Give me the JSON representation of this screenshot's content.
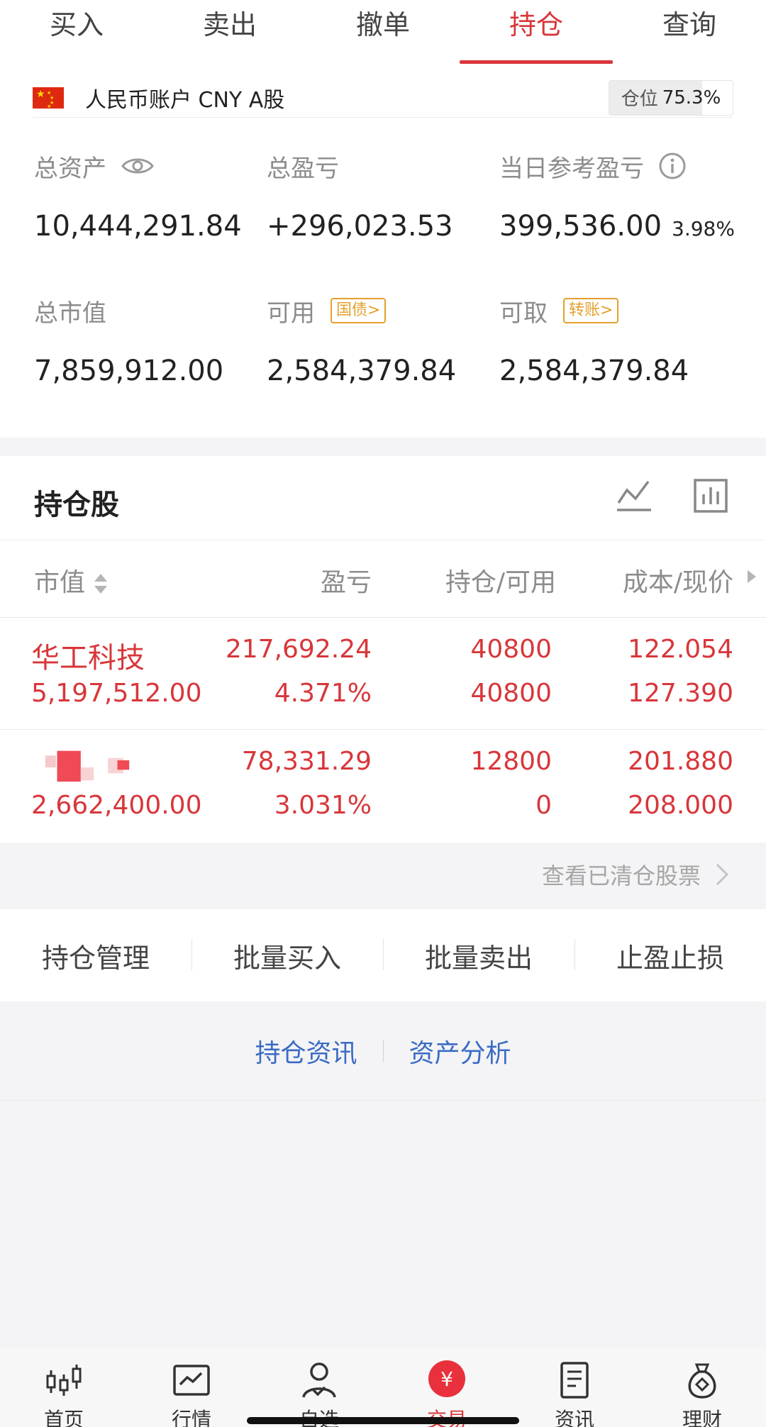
{
  "tabs": [
    "买入",
    "卖出",
    "撤单",
    "持仓",
    "查询"
  ],
  "active_tab": "持仓",
  "account": {
    "name": "人民币账户 CNY A股",
    "position_label": "仓位",
    "position_value": "75.3%"
  },
  "stats": {
    "total_assets_label": "总资产",
    "total_assets": "10,444,291.84",
    "total_pnl_label": "总盈亏",
    "total_pnl": "+296,023.53",
    "day_pnl_label": "当日参考盈亏",
    "day_pnl": "399,536.00",
    "day_pnl_pct": "3.98%",
    "market_value_label": "总市值",
    "market_value": "7,859,912.00",
    "available_label": "可用",
    "available_tag": "国债>",
    "available": "2,584,379.84",
    "withdrawable_label": "可取",
    "withdrawable_tag": "转账>",
    "withdrawable": "2,584,379.84"
  },
  "holdings": {
    "title": "持仓股",
    "columns": [
      "市值",
      "盈亏",
      "持仓/可用",
      "成本/现价"
    ],
    "rows": [
      {
        "name": "华工科技",
        "market_value": "5,197,512.00",
        "pnl": "217,692.24",
        "pnl_pct": "4.371%",
        "holding": "40800",
        "available": "40800",
        "cost": "122.054",
        "price": "127.390"
      },
      {
        "name": "",
        "market_value": "2,662,400.00",
        "pnl": "78,331.29",
        "pnl_pct": "3.031%",
        "holding": "12800",
        "available": "0",
        "cost": "201.880",
        "price": "208.000"
      }
    ],
    "view_cleared": "查看已清仓股票"
  },
  "actions": [
    "持仓管理",
    "批量买入",
    "批量卖出",
    "止盈止损"
  ],
  "links": [
    "持仓资讯",
    "资产分析"
  ],
  "bottom_nav": [
    {
      "label": "首页",
      "icon": "candlestick-icon"
    },
    {
      "label": "行情",
      "icon": "chart-icon"
    },
    {
      "label": "自选",
      "icon": "person-check-icon"
    },
    {
      "label": "交易",
      "icon": "yuan-icon"
    },
    {
      "label": "资讯",
      "icon": "document-icon"
    },
    {
      "label": "理财",
      "icon": "money-bag-icon"
    }
  ],
  "colors": {
    "accent": "#d8363a",
    "link": "#3a6bc4",
    "tag": "#e3a02c"
  }
}
